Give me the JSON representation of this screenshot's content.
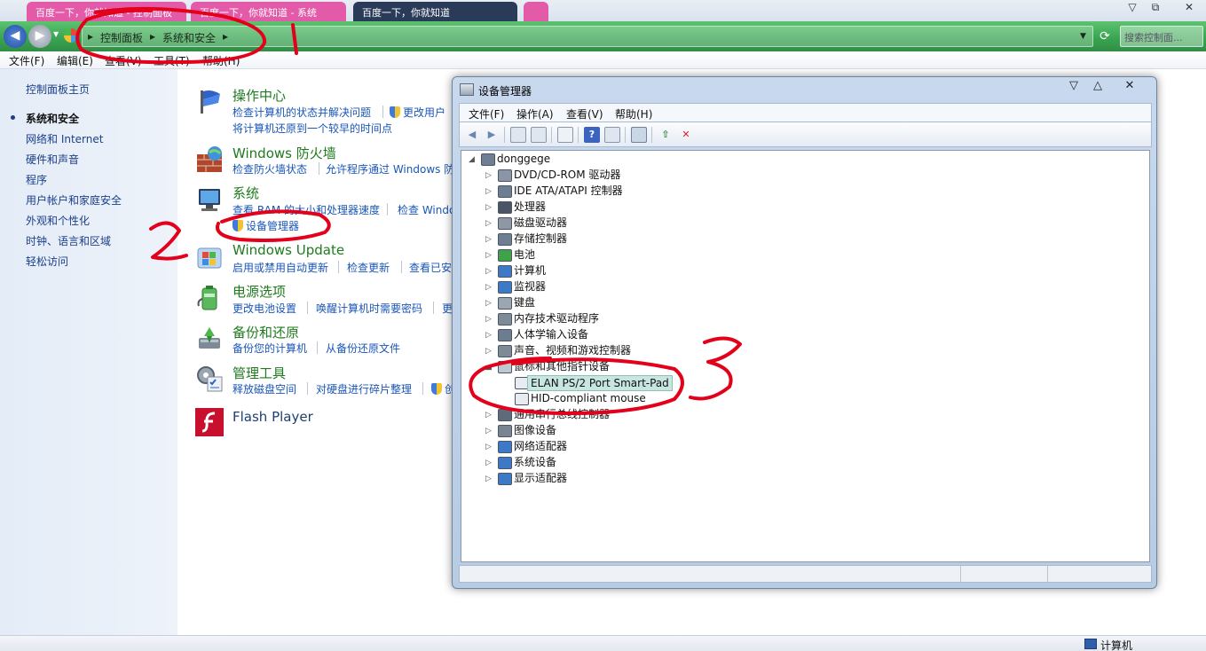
{
  "window": {
    "tabs": [
      {
        "label": "百度一下，你就知道 - 控制面板",
        "color": "#e25aa8"
      },
      {
        "label": "百度一下，你就知道 - 系统",
        "color": "#e25aa8"
      },
      {
        "label": "百度一下，你就知道",
        "color": "#2a3b5a"
      },
      {
        "label": "",
        "color": "#e25aa8"
      }
    ],
    "controls": {
      "minimize": "▽",
      "restore": "⧉",
      "close": "✕"
    }
  },
  "nav": {
    "back_icon": "arrow-left-icon",
    "forward_icon": "arrow-right-icon",
    "breadcrumbs": [
      "控制面板",
      "系统和安全"
    ],
    "search_placeholder": "搜索控制面..."
  },
  "menu": [
    "文件(F)",
    "编辑(E)",
    "查看(V)",
    "工具(T)",
    "帮助(H)"
  ],
  "sidebar": {
    "items": [
      {
        "label": "控制面板主页",
        "current": false
      },
      {
        "label": "系统和安全",
        "current": true
      },
      {
        "label": "网络和 Internet",
        "current": false
      },
      {
        "label": "硬件和声音",
        "current": false
      },
      {
        "label": "程序",
        "current": false
      },
      {
        "label": "用户帐户和家庭安全",
        "current": false
      },
      {
        "label": "外观和个性化",
        "current": false
      },
      {
        "label": "时钟、语言和区域",
        "current": false
      },
      {
        "label": "轻松访问",
        "current": false
      }
    ]
  },
  "categories": [
    {
      "title": "操作中心",
      "icon": "flag-icon",
      "links": [
        "检查计算机的状态并解决问题",
        "更改用户"
      ],
      "links2": [
        "将计算机还原到一个较早的时间点"
      ]
    },
    {
      "title": "Windows 防火墙",
      "icon": "firewall-icon",
      "links": [
        "检查防火墙状态",
        "允许程序通过 Windows 防"
      ]
    },
    {
      "title": "系统",
      "icon": "computer-icon",
      "links": [
        "查看 RAM 的大小和处理器速度",
        "检查 Windo"
      ],
      "links2": [
        "设备管理器"
      ]
    },
    {
      "title": "Windows Update",
      "icon": "windows-update-icon",
      "links": [
        "启用或禁用自动更新",
        "检查更新",
        "查看已安"
      ]
    },
    {
      "title": "电源选项",
      "icon": "battery-icon",
      "links": [
        "更改电池设置",
        "唤醒计算机时需要密码",
        "更"
      ]
    },
    {
      "title": "备份和还原",
      "icon": "backup-icon",
      "links": [
        "备份您的计算机",
        "从备份还原文件"
      ]
    },
    {
      "title": "管理工具",
      "icon": "admin-tools-icon",
      "links": [
        "释放磁盘空间",
        "对硬盘进行碎片整理",
        "创"
      ]
    },
    {
      "title": "Flash Player",
      "icon": "flash-icon",
      "links": []
    }
  ],
  "device_manager": {
    "title": "设备管理器",
    "menu": [
      "文件(F)",
      "操作(A)",
      "查看(V)",
      "帮助(H)"
    ],
    "controls": {
      "minimize": "▽",
      "maximize": "△",
      "close": "✕"
    },
    "root": "donggege",
    "tree": [
      {
        "label": "DVD/CD-ROM 驱动器",
        "expanded": false
      },
      {
        "label": "IDE ATA/ATAPI 控制器",
        "expanded": false
      },
      {
        "label": "处理器",
        "expanded": false
      },
      {
        "label": "磁盘驱动器",
        "expanded": false
      },
      {
        "label": "存储控制器",
        "expanded": false
      },
      {
        "label": "电池",
        "expanded": false
      },
      {
        "label": "计算机",
        "expanded": false
      },
      {
        "label": "监视器",
        "expanded": false
      },
      {
        "label": "键盘",
        "expanded": false
      },
      {
        "label": "内存技术驱动程序",
        "expanded": false
      },
      {
        "label": "人体学输入设备",
        "expanded": false
      },
      {
        "label": "声音、视频和游戏控制器",
        "expanded": false
      },
      {
        "label": "鼠标和其他指针设备",
        "expanded": true,
        "children": [
          "ELAN PS/2 Port Smart-Pad",
          "HID-compliant mouse"
        ]
      },
      {
        "label": "通用串行总线控制器",
        "expanded": false
      },
      {
        "label": "图像设备",
        "expanded": false
      },
      {
        "label": "网络适配器",
        "expanded": false
      },
      {
        "label": "系统设备",
        "expanded": false
      },
      {
        "label": "显示适配器",
        "expanded": false
      }
    ],
    "selected": "ELAN PS/2 Port Smart-Pad"
  },
  "statusbar": {
    "label": "计算机"
  },
  "colors": {
    "annotation": "#e3001b",
    "link": "#1a56b8",
    "category_title": "#1e7a1e",
    "nav_green": "#3aa553"
  }
}
